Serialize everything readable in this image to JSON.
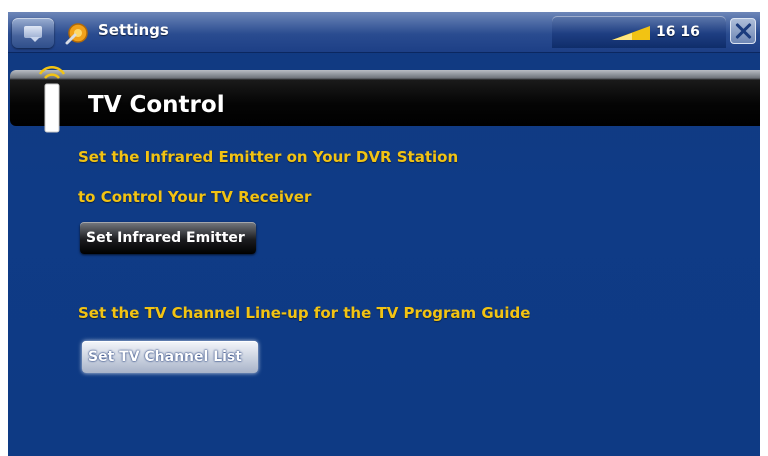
{
  "topbar": {
    "app_title": "Settings",
    "clock": "16 16",
    "icons": {
      "menu": "menu-icon",
      "settings": "settings-icon",
      "signal": "signal-strength-icon",
      "close": "close-icon"
    }
  },
  "header": {
    "title": "TV Control",
    "icon": "remote-control-icon"
  },
  "content": {
    "infrared_text_line1": "Set the Infrared Emitter on Your DVR Station",
    "infrared_text_line2": "to Control Your TV Receiver",
    "infrared_button": "Set Infrared Emitter",
    "channel_text": "Set the TV Channel Line-up for the TV Program Guide",
    "channel_button": "Set TV Channel List"
  },
  "colors": {
    "background": "#0f3b86",
    "text_accent": "#f2c313",
    "banner": "#000000"
  }
}
